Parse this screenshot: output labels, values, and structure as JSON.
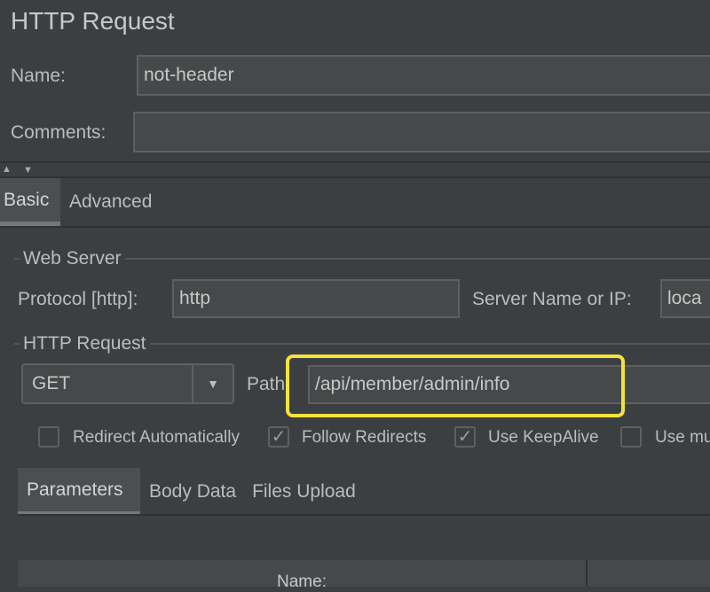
{
  "title": "HTTP Request",
  "name_label": "Name:",
  "name_value": "not-header",
  "comments_label": "Comments:",
  "comments_value": "",
  "tabs": [
    {
      "label": "Basic",
      "selected": true
    },
    {
      "label": "Advanced",
      "selected": false
    }
  ],
  "web_server": {
    "group_label": "Web Server",
    "protocol_label": "Protocol [http]:",
    "protocol_value": "http",
    "server_label": "Server Name or IP:",
    "server_value": "loca"
  },
  "http_request": {
    "group_label": "HTTP Request",
    "method": "GET",
    "path_label": "Path:",
    "path_value": "/api/member/admin/info",
    "highlight_color": "#f5e23c"
  },
  "checkboxes": [
    {
      "label": "Redirect Automatically",
      "checked": false
    },
    {
      "label": "Follow Redirects",
      "checked": true
    },
    {
      "label": "Use KeepAlive",
      "checked": true
    },
    {
      "label": "Use mu",
      "checked": false
    }
  ],
  "sub_tabs": [
    {
      "label": "Parameters",
      "selected": true
    },
    {
      "label": "Body Data",
      "selected": false
    },
    {
      "label": "Files Upload",
      "selected": false
    }
  ],
  "table": {
    "columns": [
      "Name:"
    ]
  }
}
